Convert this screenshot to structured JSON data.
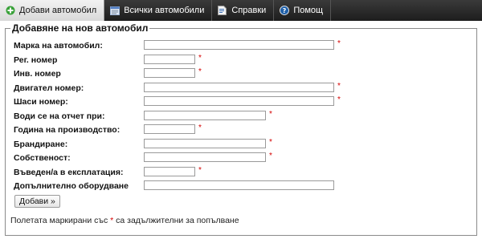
{
  "nav": {
    "tabs": [
      {
        "label": "Добави автомобил",
        "icon": "add-circle-icon",
        "active": true
      },
      {
        "label": "Всички автомобили",
        "icon": "list-window-icon",
        "active": false
      },
      {
        "label": "Справки",
        "icon": "report-document-icon",
        "active": false
      },
      {
        "label": "Помощ",
        "icon": "help-circle-icon",
        "active": false
      }
    ]
  },
  "form": {
    "legend": "Добавяне на нов автомобил",
    "fields": [
      {
        "label": "Марка на автомобил:",
        "value": "",
        "required": true
      },
      {
        "label": "Рег. номер",
        "value": "",
        "required": true
      },
      {
        "label": "Инв. номер",
        "value": "",
        "required": true
      },
      {
        "label": "Двигател номер:",
        "value": "",
        "required": true
      },
      {
        "label": "Шаси номер:",
        "value": "",
        "required": true
      },
      {
        "label": "Води се на отчет при:",
        "value": "",
        "required": true
      },
      {
        "label": "Година на производство:",
        "value": "",
        "required": true
      },
      {
        "label": "Брандиране:",
        "value": "",
        "required": true
      },
      {
        "label": "Собственост:",
        "value": "",
        "required": true
      },
      {
        "label": "Въведен/а в експлатация:",
        "value": "",
        "required": true
      },
      {
        "label": "Допълнително оборудване",
        "value": "",
        "required": false
      }
    ],
    "required_marker": "*",
    "submit_label": "Добави »",
    "footnote_before": "Полетата маркирани със",
    "footnote_after": "са задължителни за попълване"
  },
  "colors": {
    "nav_bg": "#2a2a2a",
    "required": "#d40000",
    "add_icon": "#3aa23a",
    "help_icon": "#1f5fa8"
  }
}
